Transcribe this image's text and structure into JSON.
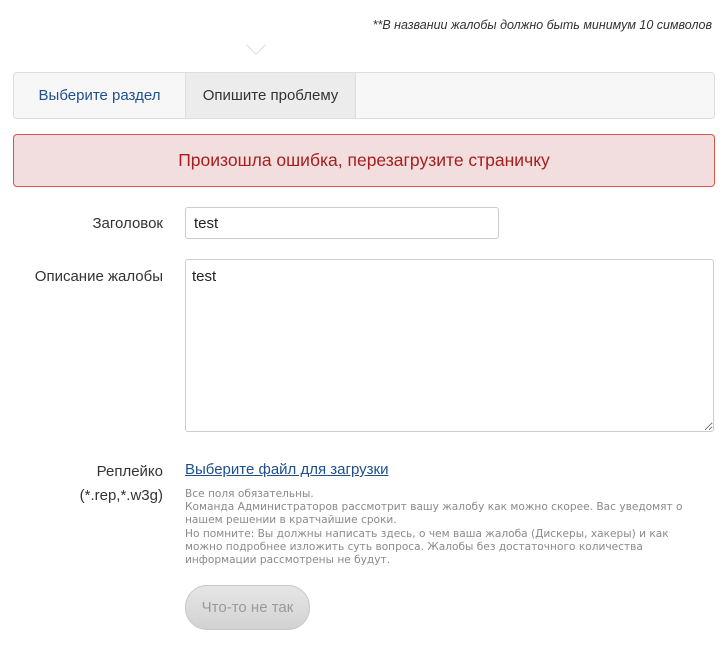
{
  "hint": "**В названии жалобы должно быть минимум 10 символов",
  "tabs": [
    {
      "label": "Выберите раздел"
    },
    {
      "label": "Опишите проблему"
    }
  ],
  "alert": "Произошла ошибка, перезагрузите страничку",
  "form": {
    "title_label": "Заголовок",
    "title_value": "test",
    "desc_label": "Описание жалобы",
    "desc_value": "test",
    "replay_label_line1": "Реплейко",
    "replay_label_line2": "(*.rep,*.w3g)",
    "file_link": "Выберите файл для загрузки",
    "help_lines": [
      "Все поля обязательны.",
      "Команда Администраторов рассмотрит вашу жалобу как можно скорее. Вас уведомят о",
      "нашем решении в кратчайшие сроки.",
      "Но помните: Вы должны написать здесь, о чем ваша жалоба (Дискеры, хакеры) и как",
      "можно подробнее изложить суть вопроса. Жалобы без достаточного количества",
      "информации рассмотрены не будут."
    ],
    "submit_label": "Что-то не так"
  },
  "colors": {
    "link": "#1e4f8f",
    "alert_bg": "#f2dede",
    "alert_border": "#d9534f",
    "alert_text": "#a61e1e"
  }
}
